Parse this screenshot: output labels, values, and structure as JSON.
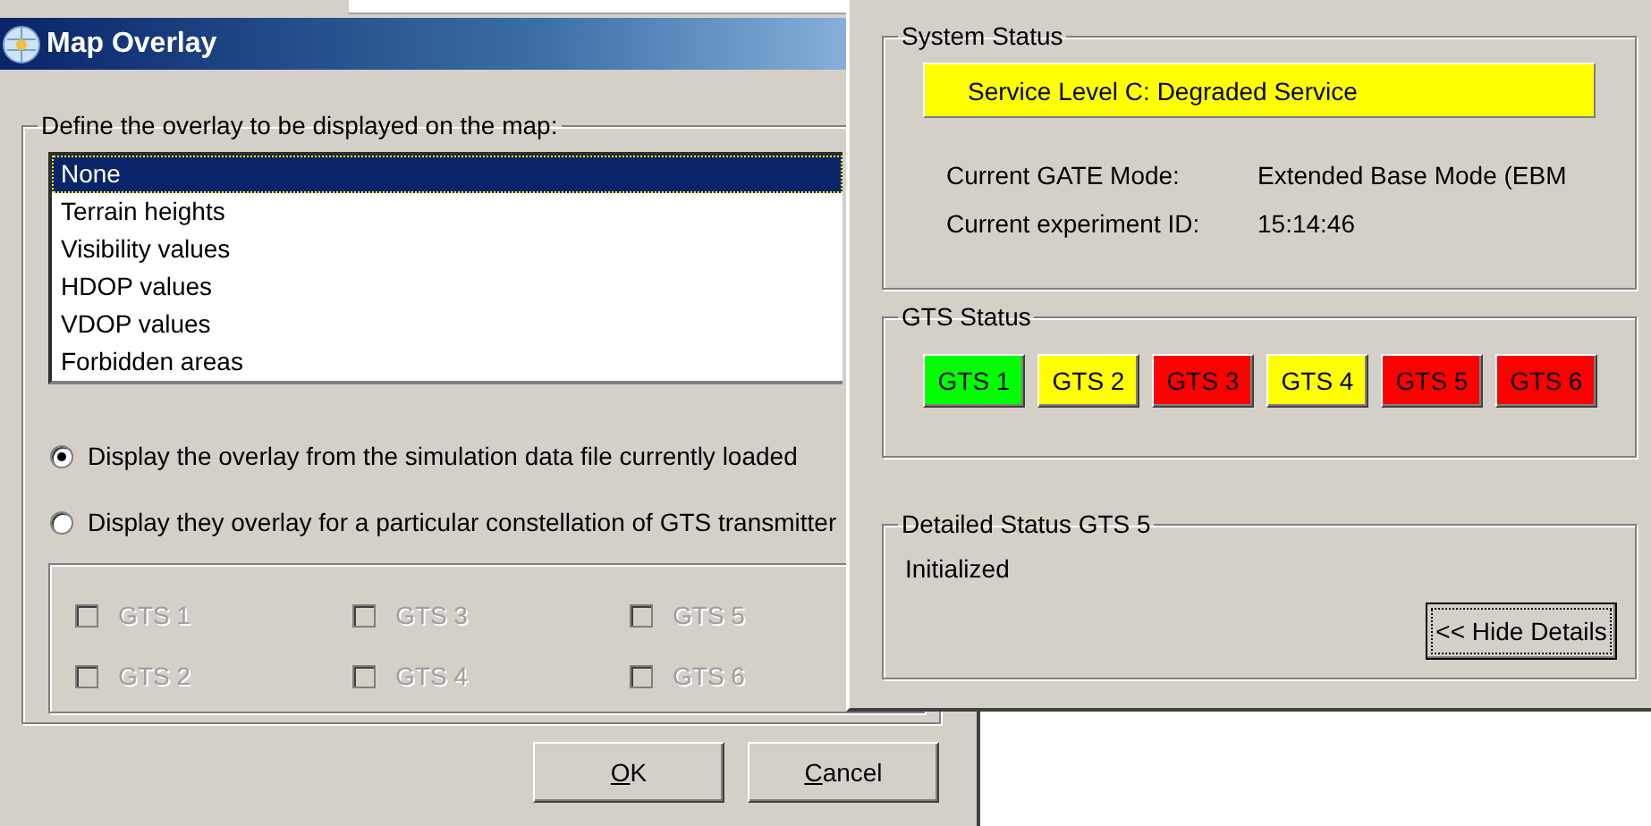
{
  "map_overlay": {
    "title": "Map Overlay",
    "overlay_group": {
      "label": "Define the overlay to be displayed on the map:",
      "items": [
        {
          "text": "None",
          "selected": true
        },
        {
          "text": "Terrain heights",
          "selected": false
        },
        {
          "text": "Visibility values",
          "selected": false
        },
        {
          "text": "HDOP values",
          "selected": false
        },
        {
          "text": "VDOP values",
          "selected": false
        },
        {
          "text": "Forbidden areas",
          "selected": false
        }
      ]
    },
    "sources": [
      {
        "label": "Display the overlay from the simulation data file currently loaded",
        "selected": true
      },
      {
        "label": "Display they overlay for a particular constellation of GTS transmitter",
        "selected": false
      }
    ],
    "transmitters": [
      {
        "label": "GTS 1",
        "checked": false,
        "disabled": true
      },
      {
        "label": "GTS 3",
        "checked": false,
        "disabled": true
      },
      {
        "label": "GTS 5",
        "checked": false,
        "disabled": true
      },
      {
        "label": "GTS 2",
        "checked": false,
        "disabled": true
      },
      {
        "label": "GTS 4",
        "checked": false,
        "disabled": true
      },
      {
        "label": "GTS 6",
        "checked": false,
        "disabled": true
      }
    ],
    "buttons": [
      {
        "label": "OK",
        "mnemonic": true
      },
      {
        "label": "Cancel",
        "mnemonic": true
      }
    ]
  },
  "status_panel": {
    "system_status": {
      "label": "System Status",
      "service_level": {
        "text": "Service Level C: Degraded Service",
        "color": "#ffff00"
      },
      "fields": [
        {
          "label": "Current GATE Mode:",
          "value": "Extended Base Mode (EBM"
        },
        {
          "label": "Current experiment ID:",
          "value": "15:14:46"
        }
      ]
    },
    "gts_status": {
      "label": "GTS Status",
      "stations": [
        {
          "label": "GTS 1",
          "color": "#00ff00"
        },
        {
          "label": "GTS 2",
          "color": "#ffff00"
        },
        {
          "label": "GTS 3",
          "color": "#ff0000"
        },
        {
          "label": "GTS 4",
          "color": "#ffff00"
        },
        {
          "label": "GTS 5",
          "color": "#ff0000"
        },
        {
          "label": "GTS 6",
          "color": "#ff0000"
        }
      ]
    },
    "detailed_status": {
      "label": "Detailed Status GTS 5",
      "text": "Initialized",
      "button": {
        "label": "<< Hide Details",
        "focused": true
      }
    }
  }
}
